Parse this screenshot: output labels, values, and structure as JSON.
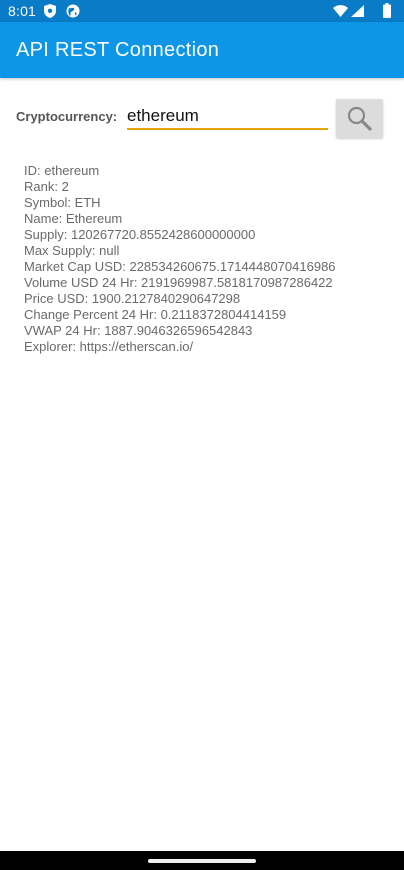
{
  "status_bar": {
    "time": "8:01",
    "left_icons": [
      "shield-icon",
      "globe-icon"
    ],
    "right_icons": [
      "wifi-icon",
      "signal-icon",
      "battery-icon"
    ]
  },
  "app_bar": {
    "title": "API REST Connection",
    "color": "#0d95e8"
  },
  "form": {
    "label": "Cryptocurrency:",
    "input_value": "ethereum",
    "underline_color": "#e8a300",
    "search_icon": "search-icon"
  },
  "info": {
    "lines": [
      "ID: ethereum",
      "Rank: 2",
      "Symbol: ETH",
      "Name: Ethereum",
      "Supply: 120267720.8552428600000000",
      "Max Supply: null",
      "Market Cap USD: 228534260675.1714448070416986",
      "Volume USD 24 Hr: 2191969987.5818170987286422",
      "Price USD: 1900.2127840290647298",
      "Change Percent 24 Hr: 0.2118372804414159",
      "VWAP 24 Hr: 1887.9046326596542843",
      "Explorer: https://etherscan.io/"
    ]
  }
}
